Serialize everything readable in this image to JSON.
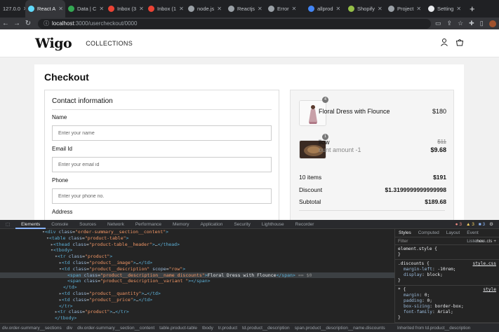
{
  "browser": {
    "tabs": [
      {
        "label": "127.0.0",
        "icon": "globe-icon",
        "color": "#9aa0a6",
        "active": false
      },
      {
        "label": "React A",
        "icon": "react-icon",
        "color": "#61dafb",
        "active": true
      },
      {
        "label": "Data | C",
        "icon": "leaf-icon",
        "color": "#34a853",
        "active": false
      },
      {
        "label": "Inbox (3",
        "icon": "gmail-icon",
        "color": "#ea4335",
        "active": false
      },
      {
        "label": "Inbox (1",
        "icon": "gmail-icon",
        "color": "#ea4335",
        "active": false
      },
      {
        "label": "node.js",
        "icon": "doc-icon",
        "color": "#9aa0a6",
        "active": false
      },
      {
        "label": "Reactjs",
        "icon": "globe-icon",
        "color": "#9aa0a6",
        "active": false
      },
      {
        "label": "Error",
        "icon": "globe-icon",
        "color": "#9aa0a6",
        "active": false
      },
      {
        "label": "allprod",
        "icon": "google-icon",
        "color": "#4285f4",
        "active": false
      },
      {
        "label": "Shopify",
        "icon": "shopify-icon",
        "color": "#95bf47",
        "active": false
      },
      {
        "label": "Project",
        "icon": "globe-icon",
        "color": "#9aa0a6",
        "active": false
      },
      {
        "label": "Setting",
        "icon": "gear-icon",
        "color": "#e8eaed",
        "active": false
      }
    ],
    "new_tab": "+",
    "url_host": "localhost",
    "url_path": ":3000/usercheckout/0000"
  },
  "site": {
    "logo": "Wigo",
    "nav_collections": "COLLECTIONS"
  },
  "checkout": {
    "title": "Checkout",
    "contact_title": "Contact information",
    "name_label": "Name",
    "name_placeholder": "Enter your name",
    "email_label": "Email Id",
    "email_placeholder": "Enter your email id",
    "phone_label": "Phone",
    "phone_placeholder": "Enter your phone no.",
    "address_label": "Address"
  },
  "summary": {
    "products": [
      {
        "qty": "4",
        "name": "Floral Dress with Flounce",
        "price": "$180"
      },
      {
        "qty": "1",
        "name": "llow",
        "discount_text": "ount amount -1",
        "old_price": "$11",
        "price": "$9.68"
      }
    ],
    "items_label": "10 items",
    "items_value": "$191",
    "discount_label": "Discount",
    "discount_value": "$1.3199999999999998",
    "subtotal_label": "Subtotal",
    "subtotal_value": "$189.68"
  },
  "devtools": {
    "tabs": [
      "Elements",
      "Console",
      "Sources",
      "Network",
      "Performance",
      "Memory",
      "Application",
      "Security",
      "Lighthouse",
      "Recorder"
    ],
    "errors": "3",
    "warnings": "3",
    "info": "3",
    "dom_lines": [
      {
        "indent": 60,
        "html": "<span class='arrow'>▾</span><span class='tag'>&lt;div</span> <span class='attr'>class</span>=<span class='val'>\"order-summary__section__content\"</span><span class='tag'>&gt;</span>"
      },
      {
        "indent": 66,
        "html": "<span class='arrow'>▾</span><span class='tag'>&lt;table</span> <span class='attr'>class</span>=<span class='val'>\"product-table\"</span><span class='tag'>&gt;</span>"
      },
      {
        "indent": 72,
        "html": "<span class='arrow'>▸</span><span class='tag'>&lt;thead</span> <span class='attr'>class</span>=<span class='val'>\"product-table__header\"</span><span class='tag'>&gt;</span>…<span class='tag'>&lt;/thead&gt;</span>"
      },
      {
        "indent": 72,
        "html": "<span class='arrow'>▾</span><span class='tag'>&lt;tbody&gt;</span>"
      },
      {
        "indent": 78,
        "html": "<span class='arrow'>▾</span><span class='tag'>&lt;tr</span> <span class='attr'>class</span>=<span class='val'>\"product\"</span><span class='tag'>&gt;</span>"
      },
      {
        "indent": 84,
        "html": "<span class='arrow'>▸</span><span class='tag'>&lt;td</span> <span class='attr'>class</span>=<span class='val'>\"product__image\"</span><span class='tag'>&gt;</span>…<span class='tag'>&lt;/td&gt;</span>"
      },
      {
        "indent": 84,
        "html": "<span class='arrow'>▾</span><span class='tag'>&lt;td</span> <span class='attr'>class</span>=<span class='val'>\"product__description\"</span> <span class='attr'>scope</span>=<span class='val'>\"row\"</span><span class='tag'>&gt;</span>"
      },
      {
        "indent": 96,
        "sel": true,
        "html": "<span class='tag'>&lt;span</span> <span class='attr'>class</span>=<span class='val'>\"product__description__name discounts\"</span><span class='tag'>&gt;</span><span class='txt'>Floral Dress with Flounce</span><span class='tag'>&lt;/span&gt;</span> <span class='dim'>== $0</span>"
      },
      {
        "indent": 96,
        "html": "<span class='tag'>&lt;span</span> <span class='attr'>class</span>=<span class='val'>\"product__description__variant \"</span><span class='tag'>&gt;&lt;/span&gt;</span>"
      },
      {
        "indent": 90,
        "html": "<span class='tag'>&lt;/td&gt;</span>"
      },
      {
        "indent": 84,
        "html": "<span class='arrow'>▸</span><span class='tag'>&lt;td</span> <span class='attr'>class</span>=<span class='val'>\"product__quantity\"</span><span class='tag'>&gt;</span>…<span class='tag'>&lt;/td&gt;</span>"
      },
      {
        "indent": 84,
        "html": "<span class='arrow'>▸</span><span class='tag'>&lt;td</span> <span class='attr'>class</span>=<span class='val'>\"product__price\"</span><span class='tag'>&gt;</span>…<span class='tag'>&lt;/td&gt;</span>"
      },
      {
        "indent": 84,
        "html": "<span class='tag'>&lt;/tr&gt;</span>"
      },
      {
        "indent": 78,
        "html": "<span class='arrow'>▸</span><span class='tag'>&lt;tr</span> <span class='attr'>class</span>=<span class='val'>\"product\"</span><span class='tag'>&gt;</span>…<span class='tag'>&lt;/tr&gt;</span>"
      },
      {
        "indent": 78,
        "html": "<span class='tag'>&lt;/tbody&gt;</span>"
      }
    ],
    "styles_tabs": [
      "Styles",
      "Computed",
      "Layout",
      "Event Listeners"
    ],
    "filter_placeholder": "Filter",
    "hov_cls": ":hov  .cls  +",
    "element_style": "element.style {",
    "rule1_selector": ".discounts {",
    "rule1_source": "style.css",
    "rule1_props": [
      [
        "margin-left",
        "-10rem;"
      ],
      [
        "display",
        "block;"
      ]
    ],
    "rule2_selector": "* {",
    "rule2_source": "style",
    "rule2_props": [
      [
        "margin",
        "0;"
      ],
      [
        "padding",
        "0;"
      ],
      [
        "box-sizing",
        "border-box;"
      ],
      [
        "font-family",
        "Arial;"
      ]
    ],
    "breadcrumbs": [
      "div.order-summary__sections",
      "div",
      "div.order-summary__section__content",
      "table.product-table",
      "tbody",
      "tr.product",
      "td.product__description",
      "span.product__description__name.discounts"
    ],
    "inherited": "Inherited from td.product__description"
  }
}
